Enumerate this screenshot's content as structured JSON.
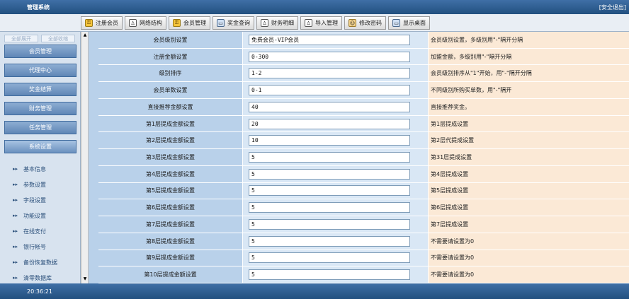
{
  "app": {
    "title": "管理系统",
    "logout_label": "[安全退出]"
  },
  "toolbar": [
    {
      "label": "注册会员",
      "icon": "yellow"
    },
    {
      "label": "网络结构",
      "icon": "person"
    },
    {
      "label": "会员管理",
      "icon": "yellow"
    },
    {
      "label": "奖金查询",
      "icon": "screen"
    },
    {
      "label": "财务明细",
      "icon": "person"
    },
    {
      "label": "导入管理",
      "icon": "person"
    },
    {
      "label": "修改密码",
      "icon": "people"
    },
    {
      "label": "显示桌面",
      "icon": "screen"
    }
  ],
  "sidebar": {
    "tabs": [
      "全部展开",
      "全部收缩"
    ],
    "menu": [
      "会员管理",
      "代理中心",
      "奖金结算",
      "财务管理",
      "任务管理",
      "系统设置"
    ],
    "active_menu": "系统设置",
    "submenu": [
      "基本信息",
      "参数设置",
      "字段设置",
      "功能设置",
      "在线支付",
      "银行帐号",
      "备份恢复数据",
      "清零数据库"
    ]
  },
  "settings": [
    {
      "label": "会员级别设置",
      "value": "免费会员-VIP会员",
      "note": "会员级别设置，多级别用\"-\"隔开分隔"
    },
    {
      "label": "注册金额设置",
      "value": "0-300",
      "note": "加盟金额，多级别用\"-\"隔开分隔"
    },
    {
      "label": "级别排序",
      "value": "1-2",
      "note": "会员级别排序从\"1\"开始，用\"-\"隔开分隔"
    },
    {
      "label": "会员单数设置",
      "value": "0-1",
      "note": "不同级别所购买单数，用\"-\"隔开"
    },
    {
      "label": "直接推荐金额设置",
      "value": "40",
      "note": "直接推荐奖金。"
    },
    {
      "label": "第1层提成金额设置",
      "value": "20",
      "note": "第1层提成设置"
    },
    {
      "label": "第2层提成金额设置",
      "value": "10",
      "note": "第2层代提成设置"
    },
    {
      "label": "第3层提成金额设置",
      "value": "5",
      "note": "第31层提成设置"
    },
    {
      "label": "第4层提成金额设置",
      "value": "5",
      "note": "第4层提成设置"
    },
    {
      "label": "第5层提成金额设置",
      "value": "5",
      "note": "第5层提成设置"
    },
    {
      "label": "第6层提成金额设置",
      "value": "5",
      "note": "第6层提成设置"
    },
    {
      "label": "第7层提成金额设置",
      "value": "5",
      "note": "第7层提成设置"
    },
    {
      "label": "第8层提成金额设置",
      "value": "5",
      "note": "不需要请设置为0"
    },
    {
      "label": "第9层提成金额设置",
      "value": "5",
      "note": "不需要请设置为0"
    },
    {
      "label": "第10层提成金额设置",
      "value": "5",
      "note": "不需要请设置为0"
    }
  ],
  "status": {
    "clock": "20:36:21"
  }
}
